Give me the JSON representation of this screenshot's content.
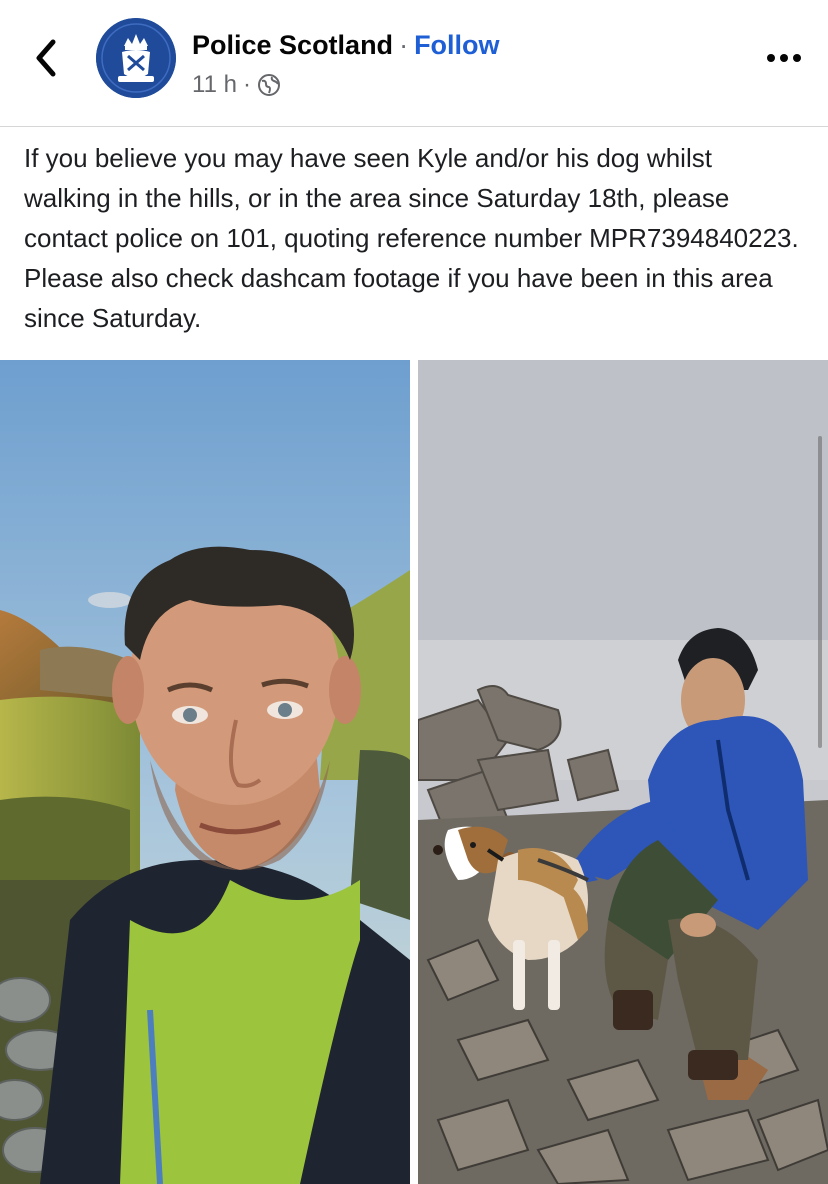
{
  "header": {
    "page_name": "Police Scotland",
    "separator": "·",
    "follow_label": "Follow",
    "time": "11 h",
    "meta_separator": "·",
    "privacy_icon": "globe-icon",
    "back_icon": "chevron-left-icon",
    "more_icon": "more-horizontal-icon",
    "avatar_icon": "police-scotland-crest-icon"
  },
  "post": {
    "text": "If you believe you may have seen Kyle and/or his dog whilst walking in the hills, or in the area since Saturday 18th, please contact police on 101, quoting reference number MPR7394840223. Please also check dashcam footage if you have been in this area since Saturday."
  },
  "colors": {
    "follow": "#1f5fd6",
    "avatar_bg": "#1f4b9a",
    "muted_text": "#65676b"
  }
}
